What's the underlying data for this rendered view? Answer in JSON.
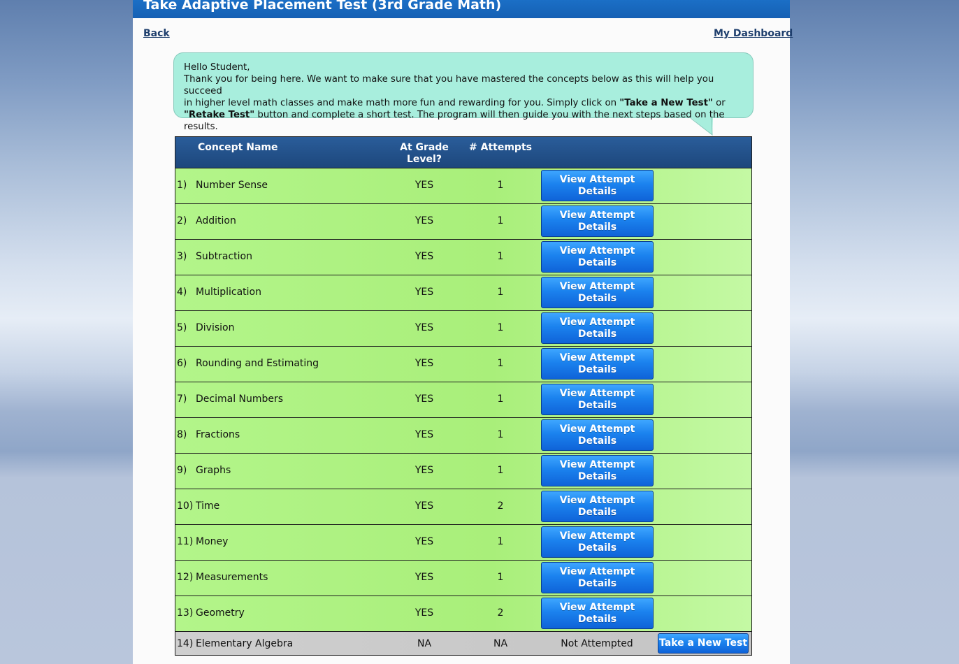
{
  "header": {
    "title": "Take Adaptive Placement Test (3rd Grade Math)"
  },
  "nav": {
    "back_label": "Back",
    "dashboard_label": "My Dashboard"
  },
  "message": {
    "greeting": "Hello Student,",
    "line1": "Thank you for being here. We want to make sure that you have mastered the concepts below as this will help you succeed",
    "line2_pre": "in higher level math classes and make math more fun and rewarding for you. Simply click on ",
    "take_new_test_quote": "\"Take a New Test\"",
    "or": " or",
    "retake_test_quote": "\"Retake Test\"",
    "line3_post": " button and complete a short test. The program will then guide you with the next steps based on the results."
  },
  "table": {
    "headers": {
      "concept": "Concept Name",
      "grade_line1": "At Grade",
      "grade_line2": "Level?",
      "attempts": "# Attempts"
    },
    "view_button_line1": "View Attempt",
    "view_button_line2": "Details",
    "rows": [
      {
        "num": "1)",
        "name": "Number Sense",
        "grade": "YES",
        "attempts": "1"
      },
      {
        "num": "2)",
        "name": "Addition",
        "grade": "YES",
        "attempts": "1"
      },
      {
        "num": "3)",
        "name": "Subtraction",
        "grade": "YES",
        "attempts": "1"
      },
      {
        "num": "4)",
        "name": "Multiplication",
        "grade": "YES",
        "attempts": "1"
      },
      {
        "num": "5)",
        "name": "Division",
        "grade": "YES",
        "attempts": "1"
      },
      {
        "num": "6)",
        "name": "Rounding and Estimating",
        "grade": "YES",
        "attempts": "1"
      },
      {
        "num": "7)",
        "name": "Decimal Numbers",
        "grade": "YES",
        "attempts": "1"
      },
      {
        "num": "8)",
        "name": "Fractions",
        "grade": "YES",
        "attempts": "1"
      },
      {
        "num": "9)",
        "name": "Graphs",
        "grade": "YES",
        "attempts": "1"
      },
      {
        "num": "10)",
        "name": "Time",
        "grade": "YES",
        "attempts": "2"
      },
      {
        "num": "11)",
        "name": "Money",
        "grade": "YES",
        "attempts": "1"
      },
      {
        "num": "12)",
        "name": "Measurements",
        "grade": "YES",
        "attempts": "1"
      },
      {
        "num": "13)",
        "name": "Geometry",
        "grade": "YES",
        "attempts": "2"
      }
    ],
    "last_row": {
      "num": "14)",
      "name": "Elementary Algebra",
      "grade": "NA",
      "attempts": "NA",
      "status": "Not Attempted",
      "button": "Take a New Test"
    }
  }
}
